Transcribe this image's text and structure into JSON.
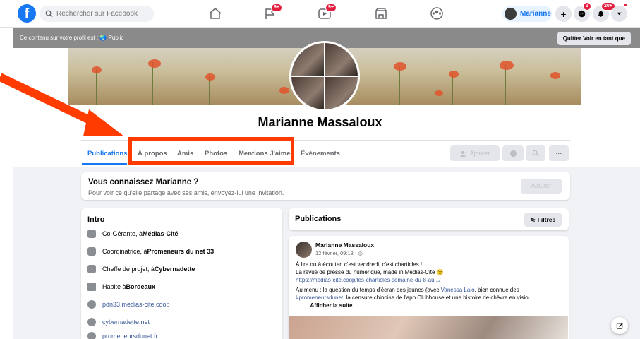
{
  "topbar": {
    "search_placeholder": "Rechercher sur Facebook",
    "user_name": "Marianne",
    "badge_groups": "9+",
    "badge_watch": "9+",
    "badge_messenger": "1",
    "badge_notifications": "20+"
  },
  "viewas": {
    "text": "Ce contenu sur votre profil est : 🌏 Public",
    "quit_label": "Quitter Voir en tant que"
  },
  "profile": {
    "name": "Marianne Massaloux"
  },
  "tabs": [
    {
      "label": "Publications"
    },
    {
      "label": "À propos"
    },
    {
      "label": "Amis"
    },
    {
      "label": "Photos"
    },
    {
      "label": "Mentions J'aime"
    },
    {
      "label": "Évènements"
    }
  ],
  "actions": {
    "add_label": "Ajouter",
    "more_label": "···"
  },
  "know": {
    "title": "Vous connaissez Marianne ?",
    "subtitle": "Pour voir ce qu'elle partage avec ses amis, envoyez-lui une invitation.",
    "button": "Ajouter"
  },
  "intro": {
    "title": "Intro",
    "items": [
      {
        "prefix": "Co-Gérante, à ",
        "strong": "Médias-Cité"
      },
      {
        "prefix": "Coordinatrice, à ",
        "strong": "Promeneurs du net 33"
      },
      {
        "prefix": "Cheffe de projet, à ",
        "strong": "Cybernadette"
      },
      {
        "prefix": "Habite à ",
        "strong": "Bordeaux"
      },
      {
        "link": "pdn33.medias-cite.coop"
      },
      {
        "link": "cybernadette.net"
      },
      {
        "link": "promeneursdunet.fr"
      }
    ]
  },
  "publications": {
    "title": "Publications",
    "filter_label": "Filtres",
    "post": {
      "author": "Marianne Massaloux",
      "date": "12 février, 09:18 · ",
      "line1": "À lire ou à écouter, c'est vendredi, c'est charticles !",
      "line2": "La revue de presse du numérique, made in Médias-Cité 😉",
      "link": "https://medias-cite.coop/les-charticles-semaine-du-8-au.../",
      "menu_prefix": "Au menu : la question du temps d'écran des jeunes (avec ",
      "menu_mention": "Vanessa Lalo",
      "menu_suffix": ", bien connue des",
      "hashtag": "#promeneursdunet",
      "line4_suffix": ", la censure chinoise de l'app Clubhouse et une histoire de chèvre en visio",
      "more_prefix": "… … ",
      "more_label": "Afficher la suite"
    }
  },
  "colors": {
    "brand": "#1877f2",
    "highlight": "#ff3b00"
  }
}
